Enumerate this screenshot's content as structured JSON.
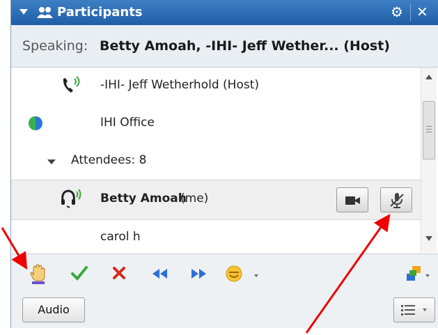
{
  "panel": {
    "title": "Participants"
  },
  "speaking": {
    "label": "Speaking:",
    "names": "Betty Amoah, -IHI- Jeff Wether... (Host)"
  },
  "participants": [
    {
      "name": "-IHI- Jeff Wetherhold (Host)",
      "icon": "phone-speaking-icon"
    },
    {
      "name": "IHI Office",
      "icon": "globe-icon"
    },
    {
      "name": "Attendees: 8",
      "icon": "expand-triangle-icon"
    },
    {
      "name": "Betty Amoah",
      "suffix": "(me)",
      "icon": "headset-speaking-icon"
    },
    {
      "name": "carol h",
      "icon": ""
    }
  ],
  "toolbar": {
    "icons": [
      "raise-hand-icon",
      "checkmark-icon",
      "x-icon",
      "rewind-icon",
      "fast-forward-icon",
      "emoticon-icon",
      "share-icon"
    ],
    "audio_label": "Audio"
  },
  "colors": {
    "title_bar": "#2a6db5",
    "annotation_arrow": "#ee0000",
    "check": "#3aa63a",
    "cross": "#d62a1e",
    "media_blue": "#2e6fd6"
  }
}
